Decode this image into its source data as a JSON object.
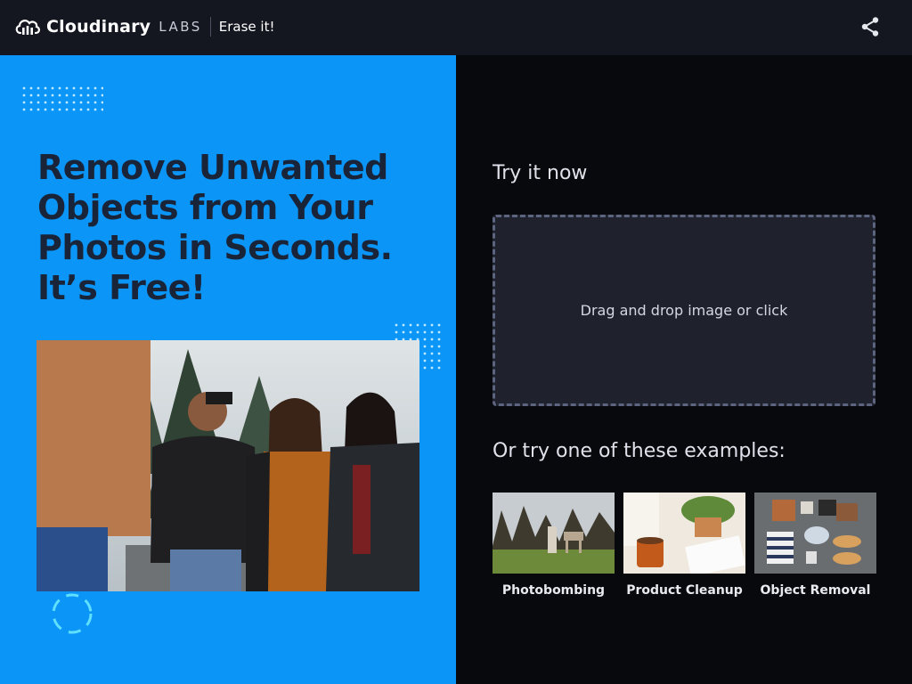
{
  "header": {
    "brand": "Cloudinary",
    "labs": "LABS",
    "product": "Erase it!",
    "icons": {
      "logo": "cloud-logo-icon",
      "share": "share-icon"
    }
  },
  "hero": {
    "headline": "Remove Unwanted Objects from Your Photos in Seconds. It’s Free!",
    "image_icon": "friends-photo"
  },
  "try": {
    "title": "Try it now",
    "dropzone_text": "Drag and drop image or click"
  },
  "examples": {
    "title": "Or try one of these examples:",
    "items": [
      {
        "label": "Photobombing"
      },
      {
        "label": "Product Cleanup"
      },
      {
        "label": "Object Removal"
      }
    ]
  },
  "colors": {
    "left_panel": "#0b95f7",
    "topbar": "#141620",
    "right_panel": "#08090c",
    "headline": "#1a2438",
    "dropzone": "#1f212d"
  }
}
